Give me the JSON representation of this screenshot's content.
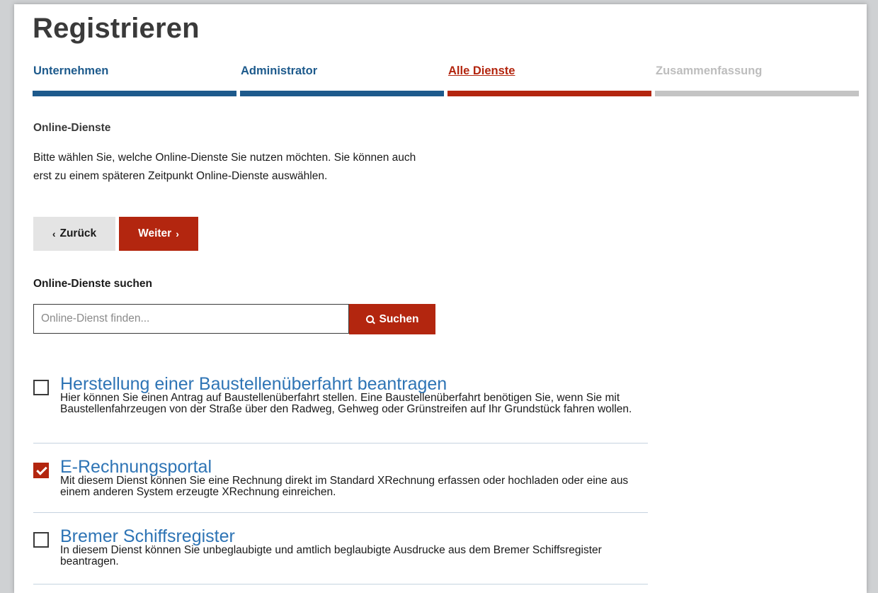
{
  "page": {
    "title": "Registrieren"
  },
  "steps": [
    {
      "label": "Unternehmen",
      "state": "done"
    },
    {
      "label": "Administrator",
      "state": "done"
    },
    {
      "label": "Alle Dienste",
      "state": "active"
    },
    {
      "label": "Zusammenfassung",
      "state": "todo"
    }
  ],
  "section": {
    "heading": "Online-Dienste",
    "intro": "Bitte wählen Sie, welche Online-Dienste Sie nutzen möchten. Sie können auch erst zu einem späteren Zeitpunkt Online-Dienste auswählen."
  },
  "nav": {
    "back_label": "Zurück",
    "next_label": "Weiter"
  },
  "search": {
    "label": "Online-Dienste suchen",
    "placeholder": "Online-Dienst finden...",
    "value": "",
    "button_label": "Suchen"
  },
  "services": [
    {
      "title": "Herstellung einer Baustellenüberfahrt beantragen",
      "description": "Hier können Sie einen Antrag auf Baustellenüberfahrt stellen. Eine Baustellenüberfahrt benötigen Sie, wenn Sie mit Baustellenfahrzeugen von der Straße über den Radweg, Gehweg oder Grünstreifen auf Ihr Grundstück fahren wollen.",
      "checked": false
    },
    {
      "title": "E-Rechnungsportal",
      "description": "Mit diesem Dienst können Sie eine Rechnung direkt im Standard XRechnung erfassen oder hochladen oder eine aus einem anderen System erzeugte XRechnung einreichen.",
      "checked": true
    },
    {
      "title": "Bremer Schiffsregister",
      "description": "In diesem Dienst können Sie unbeglaubigte und amtlich beglaubigte Ausdrucke aus dem Bremer Schiffsregister beantragen.",
      "checked": false
    }
  ],
  "colors": {
    "brand_red": "#b3260f",
    "step_done_blue": "#1d5a8c",
    "link_blue": "#2e74b5",
    "step_todo_gray": "#c4c4c4"
  },
  "icons": {
    "back": "chevron-left-icon",
    "next": "chevron-right-icon",
    "search": "search-icon",
    "checkbox": "checkmark-icon"
  }
}
